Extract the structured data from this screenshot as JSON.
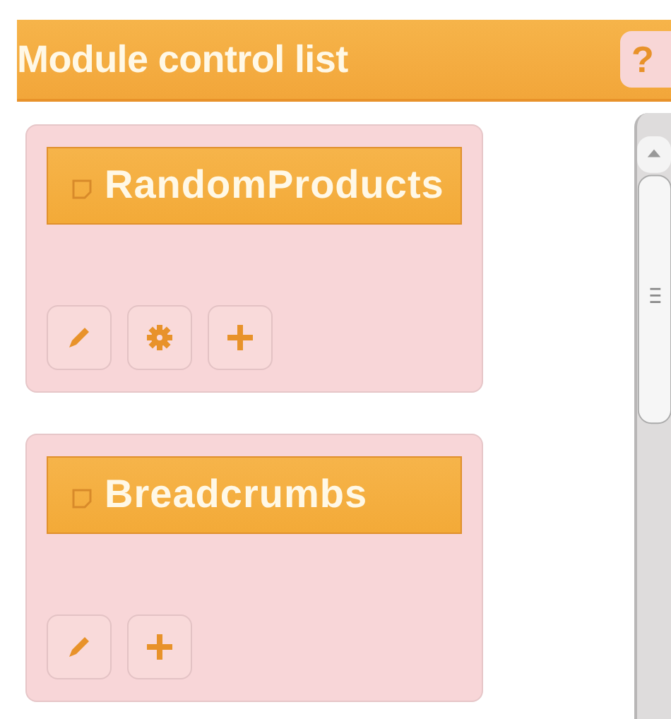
{
  "panel": {
    "title": "Module control list",
    "help_button": "?"
  },
  "modules": [
    {
      "name": "RandomProducts",
      "actions": [
        {
          "kind": "edit"
        },
        {
          "kind": "settings"
        },
        {
          "kind": "add"
        }
      ]
    },
    {
      "name": "Breadcrumbs",
      "actions": [
        {
          "kind": "edit"
        },
        {
          "kind": "add"
        }
      ]
    }
  ]
}
